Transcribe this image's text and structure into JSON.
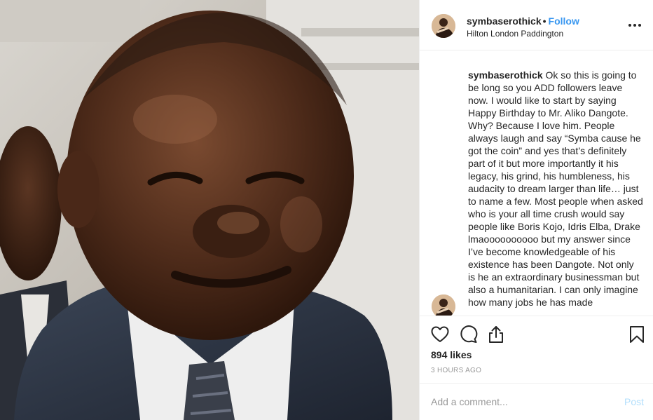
{
  "post": {
    "username": "symbaserothick",
    "separator": "•",
    "follow_label": "Follow",
    "location": "Hilton London Paddington",
    "more_icon": "more-options-icon",
    "photo_description_icon": "post-photo"
  },
  "caption": {
    "username": "symbaserothick",
    "text": "Ok so this is going to be long so you ADD followers leave now. I would like to start by saying Happy Birthday to Mr. Aliko Dangote. Why? Because I love him. People always laugh and say “Symba cause he got the coin” and yes that’s definitely part of it but more importantly it his legacy, his grind, his humbleness, his audacity to dream larger than life… just to name a few. Most people when asked who is your all time crush would say people like Boris Kojo, Idris Elba, Drake lmaoooooooooo but my answer since I’ve become knowledgeable of his existence has been Dangote. Not only is he an extraordinary businessman but also a humanitarian. I can only imagine how many jobs he has made"
  },
  "actions": {
    "like_icon": "heart-icon",
    "comment_icon": "comment-icon",
    "share_icon": "share-icon",
    "save_icon": "bookmark-icon"
  },
  "likes": "894 likes",
  "timestamp": "3 HOURS AGO",
  "comment": {
    "placeholder": "Add a comment...",
    "post_label": "Post"
  },
  "colors": {
    "link_blue": "#3897f0",
    "post_disabled": "#b2dffc",
    "muted_gray": "#999999",
    "divider": "#efefef"
  }
}
